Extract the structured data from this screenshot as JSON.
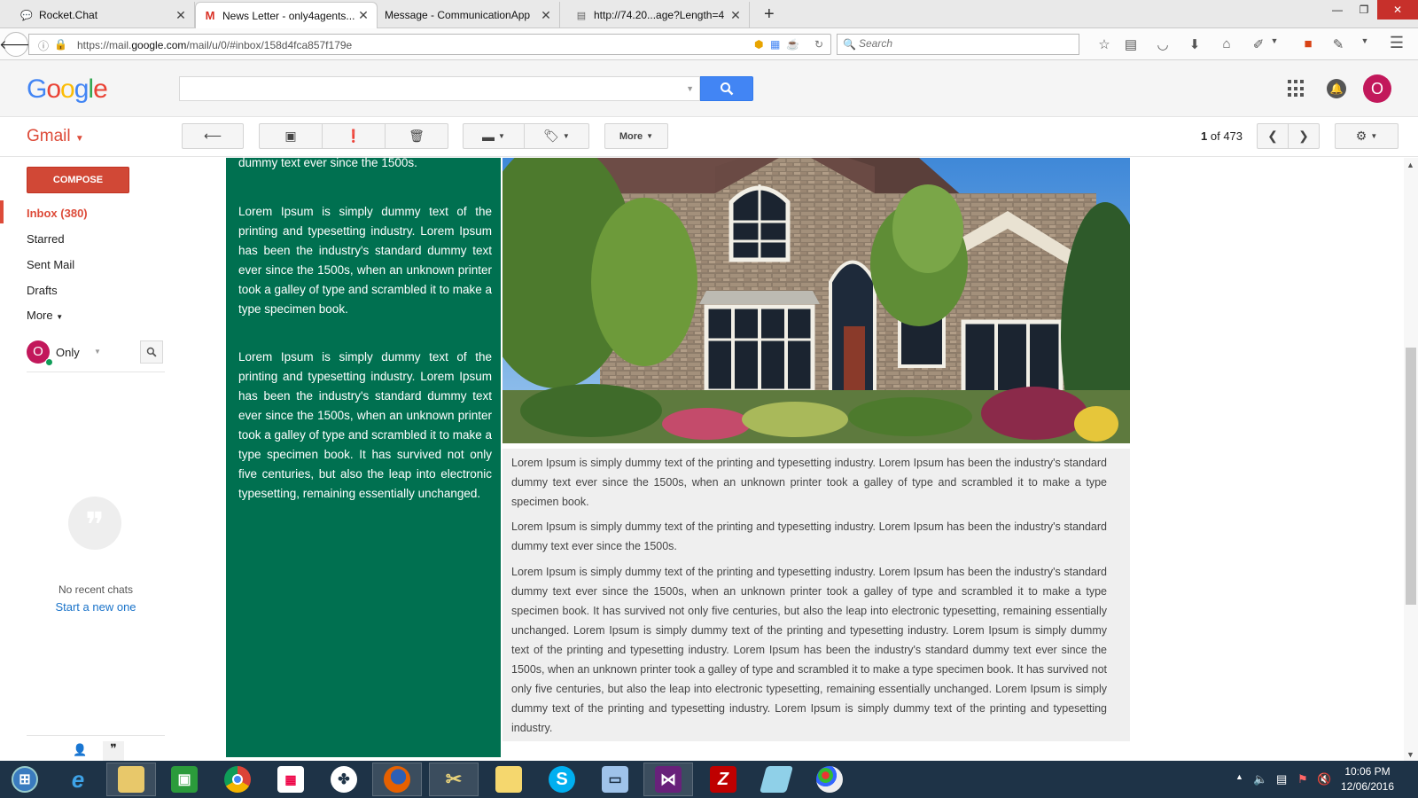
{
  "browser": {
    "tabs": [
      {
        "label": "Rocket.Chat",
        "icon": "rocketchat-icon"
      },
      {
        "label": "News Letter - only4agents...",
        "icon": "gmail-icon"
      },
      {
        "label": "Message - CommunicationApp",
        "icon": "blank-icon"
      },
      {
        "label": "http://74.20...age?Length=4",
        "icon": "page-icon"
      }
    ],
    "url_prefix": "https://mail.",
    "url_domain": "google.com",
    "url_suffix": "/mail/u/0/#inbox/158d4fca857f179e",
    "search_placeholder": "Search"
  },
  "gmail": {
    "logo_letters": [
      "G",
      "o",
      "o",
      "g",
      "l",
      "e"
    ],
    "logo_colors": [
      "#4285f4",
      "#ea4335",
      "#fbbc05",
      "#4285f4",
      "#34a853",
      "#ea4335"
    ],
    "account_initial": "O",
    "label": "Gmail",
    "more_label": "More",
    "pager_current": "1",
    "pager_of": "of",
    "pager_total": "473",
    "compose_label": "COMPOSE",
    "nav": [
      "Inbox (380)",
      "Starred",
      "Sent Mail",
      "Drafts",
      "More"
    ],
    "hangouts_user": "Only",
    "no_recent_chats": "No recent chats",
    "start_new": "Start a new one"
  },
  "email": {
    "green_paragraphs": [
      "dummy text ever since the 1500s.",
      "Lorem Ipsum is simply dummy text of the printing and typesetting industry. Lorem Ipsum has been the industry's standard dummy text ever since the 1500s, when an unknown printer took a galley of type and scrambled it to make a type specimen book.",
      "Lorem Ipsum is simply dummy text of the printing and typesetting industry. Lorem Ipsum has been the industry's standard dummy text ever since the 1500s, when an unknown printer took a galley of type and scrambled it to make a type specimen book. It has survived not only five centuries, but also the leap into electronic typesetting, remaining essentially unchanged."
    ],
    "gray_paragraphs": [
      "Lorem Ipsum is simply dummy text of the printing and typesetting industry. Lorem Ipsum has been the industry's standard dummy text ever since the 1500s, when an unknown printer took a galley of type and scrambled it to make a type specimen book.",
      "Lorem Ipsum is simply dummy text of the printing and typesetting industry. Lorem Ipsum has been the industry's standard dummy text ever since the 1500s.",
      "Lorem Ipsum is simply dummy text of the printing and typesetting industry. Lorem Ipsum has been the industry's standard dummy text ever since the 1500s, when an unknown printer took a galley of type and scrambled it to make a type specimen book. It has survived not only five centuries, but also the leap into electronic typesetting, remaining essentially unchanged. Lorem Ipsum is simply dummy text of the printing and typesetting industry. Lorem Ipsum is simply dummy text of the printing and typesetting industry. Lorem Ipsum has been the industry's standard dummy text ever since the 1500s, when an unknown printer took a galley of type and scrambled it to make a type specimen book. It has survived not only five centuries, but also the leap into electronic typesetting, remaining essentially unchanged. Lorem Ipsum is simply dummy text of the printing and typesetting industry. Lorem Ipsum is simply dummy text of the printing and typesetting industry."
    ]
  },
  "taskbar": {
    "time": "10:06 PM",
    "date": "12/06/2016",
    "apps": [
      "start-orb",
      "internet-explorer-icon",
      "file-explorer-icon",
      "store-icon",
      "chrome-icon",
      "apps-grid-icon",
      "tree-app-icon",
      "firefox-icon",
      "tools-icon",
      "folder-icon",
      "skype-icon",
      "remote-desktop-icon",
      "visual-studio-icon",
      "filezilla-icon",
      "eraser-icon",
      "paint-icon"
    ]
  },
  "colors": {
    "gmail_red": "#dd4b39",
    "email_green": "#007050",
    "search_blue": "#4285f4"
  }
}
